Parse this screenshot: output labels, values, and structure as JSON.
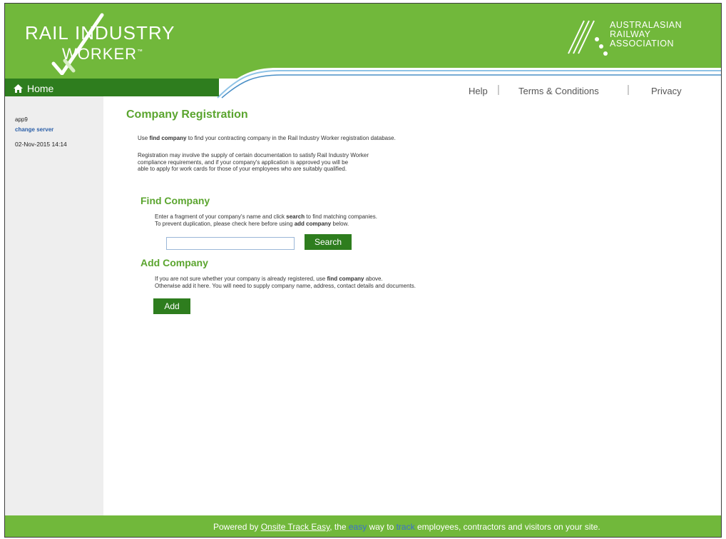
{
  "header": {
    "logo_line1": "RAIL",
    "logo_line1b": "INDUSTRY",
    "logo_line2": "WORKER",
    "logo_tm": "™",
    "ara_line1": "AUSTRALASIAN",
    "ara_line2": "RAILWAY",
    "ara_line3": "ASSOCIATION"
  },
  "nav": {
    "home": "Home",
    "help": "Help",
    "terms": "Terms & Conditions",
    "privacy": "Privacy"
  },
  "sidebar": {
    "user": "app9",
    "change_server": "change server",
    "datetime": "02-Nov-2015 14:14"
  },
  "main": {
    "title": "Company Registration",
    "intro_pre": "Use ",
    "intro_bold": "find company",
    "intro_post": " to find your contracting company in the Rail Industry Worker registration database.",
    "reg_line1": "Registration may involve the supply of certain documentation to satisfy Rail Industry Worker",
    "reg_line2": "compliance requirements, and if your company's application is approved you will be",
    "reg_line3": "able to apply for work cards for those of your employees who are suitably qualified.",
    "find": {
      "title": "Find Company",
      "line1_pre": "Enter a fragment of your company's name and click ",
      "line1_bold": "search",
      "line1_post": " to find matching companies.",
      "line2_pre": "To prevent duplication, please check here before using ",
      "line2_bold": "add company",
      "line2_post": " below.",
      "input_value": "",
      "search_label": "Search"
    },
    "add": {
      "title": "Add Company",
      "line1_pre": "If you are not sure whether your company is already registered, use ",
      "line1_bold": "find company",
      "line1_post": " above.",
      "line2": "Otherwise add it here. You will need to supply company name, address, contact details and documents.",
      "add_label": "Add"
    }
  },
  "footer": {
    "pre": "Powered by ",
    "link": "Onsite Track Easy",
    "mid1": ", the ",
    "easy": "easy",
    "mid2": " way to ",
    "track": "track",
    "post": " employees, contractors and visitors on your site."
  },
  "colors": {
    "brand_green": "#71b83b",
    "dark_green": "#2e7d1e",
    "title_green": "#5ba52f"
  }
}
